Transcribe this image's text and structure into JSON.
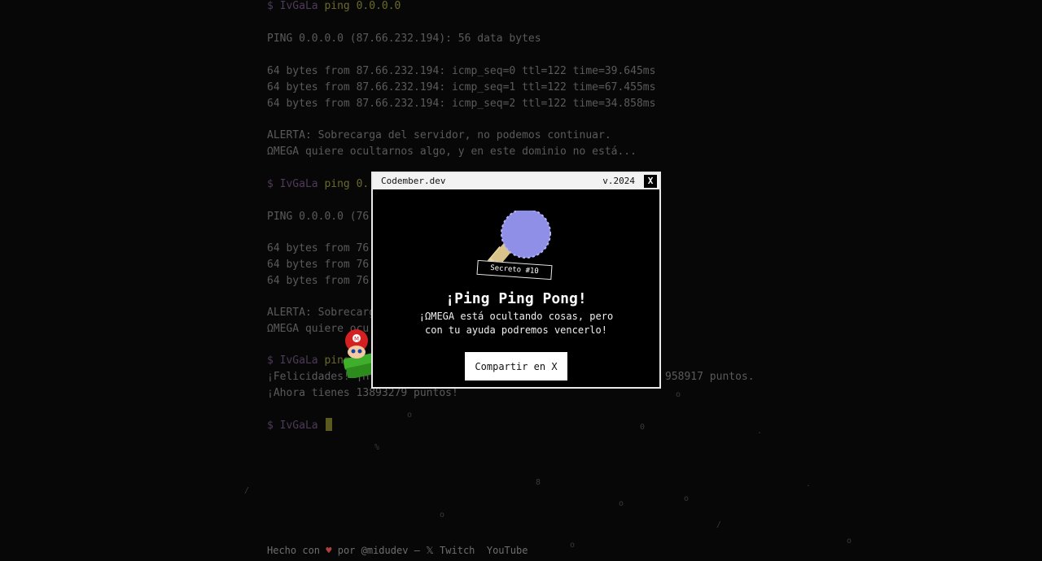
{
  "terminal": {
    "user": "IvGaLa",
    "cmd": "ping 0.0.0.0",
    "cmd_partial": "ping 0.",
    "ping_header": "PING 0.0.0.0 (87.66.232.194): 56 data bytes",
    "ping_header_partial": "PING 0.0.0.0 (76",
    "replies": [
      "64 bytes from 87.66.232.194: icmp_seq=0 ttl=122 time=39.645ms",
      "64 bytes from 87.66.232.194: icmp_seq=1 ttl=122 time=67.455ms",
      "64 bytes from 87.66.232.194: icmp_seq=2 ttl=122 time=34.858ms"
    ],
    "reply_partial": "64 bytes from 76",
    "alert_1": "ALERTA: Sobrecarga del servidor, no podemos continuar.",
    "alert_2": "ΩMEGA quiere ocultarnos algo, y en este dominio no está...",
    "alert_1_partial": "ALERTA: Sobrecarg",
    "alert_2_partial": "ΩMEGA quiere ocu",
    "cmd_partial_2": "ping",
    "congrats_start": "¡Felicidades! ¡H",
    "congrats_end": "958917 puntos.",
    "points": "¡Ahora tienes 13893279 puntos!"
  },
  "modal": {
    "title": "Codember.dev",
    "version": "v.2024",
    "close_label": "X",
    "badge": "Secreto #10",
    "heading": "¡Ping Ping Pong!",
    "text_line_1": "¡ΩMEGA está ocultando cosas, pero",
    "text_line_2": "con tu ayuda podremos vencerlo!",
    "share_label": "Compartir en X"
  },
  "footer": {
    "made_with": "Hecho con",
    "by": "por @midudev",
    "dash": "—",
    "x_label": "𝕏",
    "twitch": "Twitch",
    "youtube": "YouTube"
  },
  "colors": {
    "background": "#0b0b0b",
    "prompt_user": "#7a5a8a",
    "prompt_cmd": "#a4a240",
    "paddle": "#8f8fe8"
  }
}
